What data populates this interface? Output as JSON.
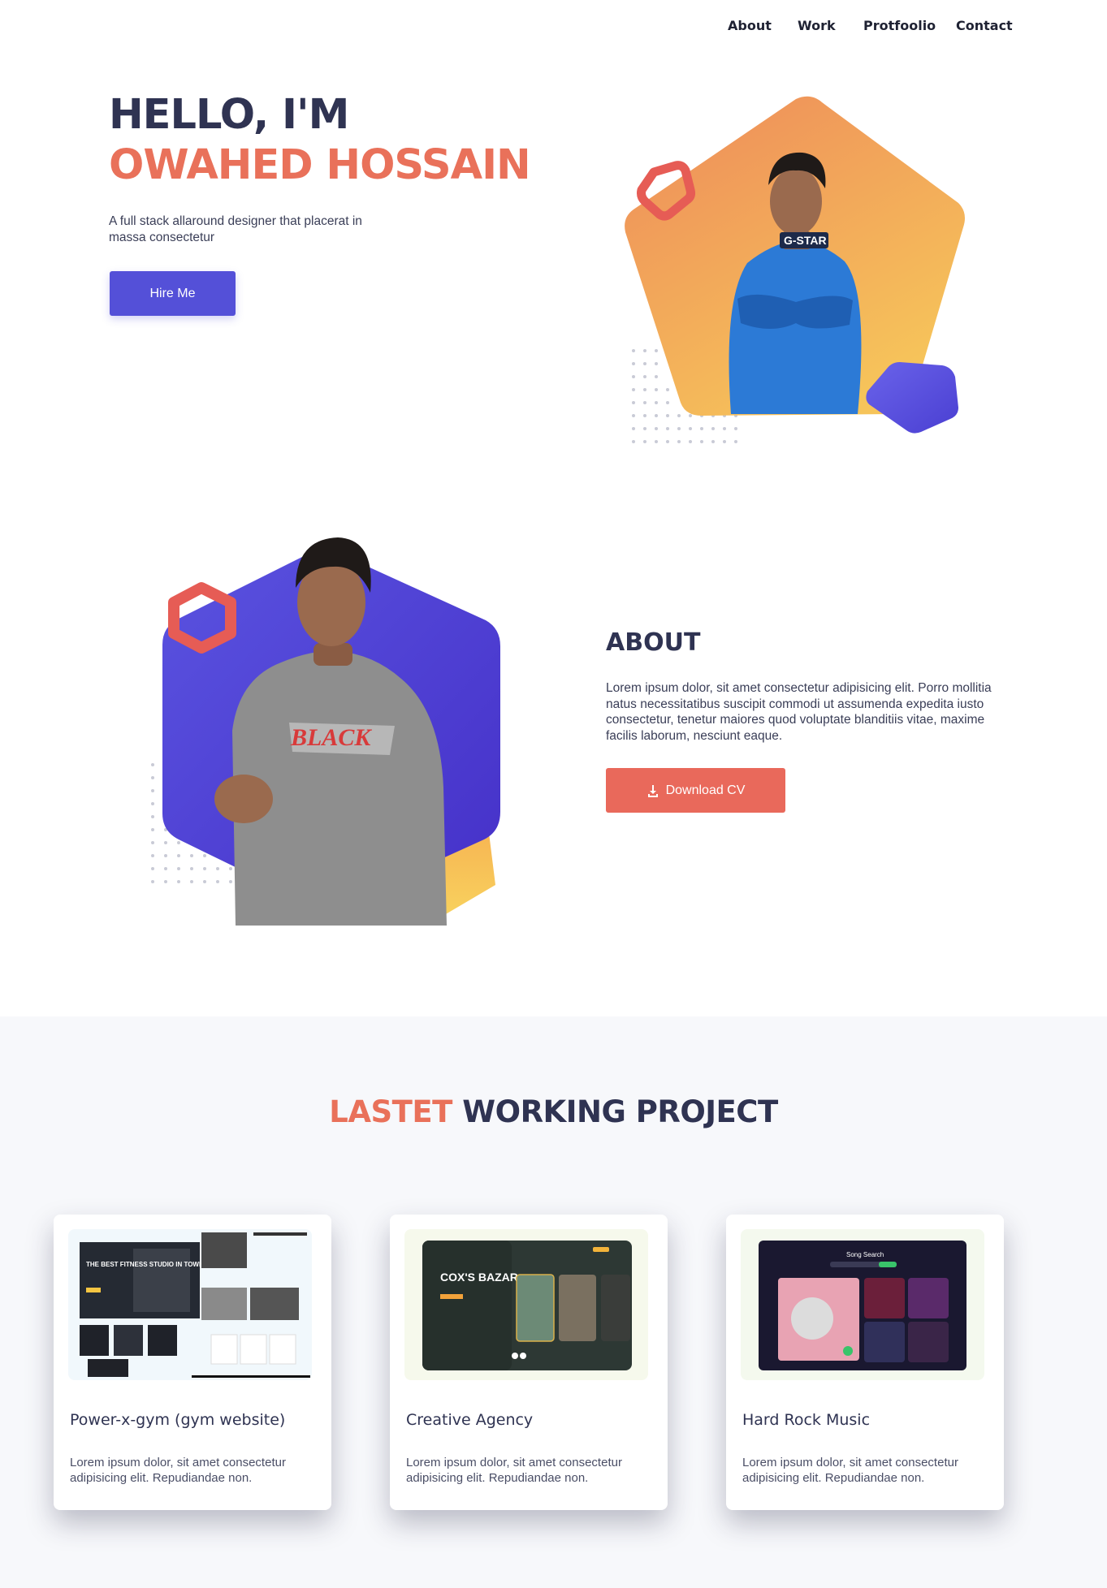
{
  "nav": {
    "items": [
      {
        "label": "About"
      },
      {
        "label": "Work"
      },
      {
        "label": "Protfoolio"
      },
      {
        "label": "Contact"
      }
    ]
  },
  "hero": {
    "greeting": "HELLO, I'M",
    "name": "OWAHED HOSSAIN",
    "description": "A full stack allaround designer that placerat in massa consectetur",
    "hire_button": "Hire Me"
  },
  "about": {
    "title": "ABOUT",
    "text": "Lorem ipsum dolor, sit amet consectetur adipisicing elit. Porro mollitia natus necessitatibus suscipit commodi ut assumenda expedita iusto consectetur, tenetur maiores quod voluptate blanditiis vitae, maxime facilis laborum, nesciunt eaque.",
    "download_button": "Download CV"
  },
  "projects": {
    "title_accent": "LASTET",
    "title_rest": "WORKING PROJECT",
    "cards": [
      {
        "title": "Power-x-gym (gym website)",
        "desc": "Lorem ipsum dolor, sit amet consectetur adipisicing elit. Repudiandae non.",
        "thumb_text": "THE BEST FITNESS STUDIO IN TOWN"
      },
      {
        "title": "Creative Agency",
        "desc": "Lorem ipsum dolor, sit amet consectetur adipisicing elit. Repudiandae non.",
        "thumb_text": "COX'S BAZAR"
      },
      {
        "title": "Hard Rock Music",
        "desc": "Lorem ipsum dolor, sit amet consectetur adipisicing elit. Repudiandae non.",
        "thumb_text": "Song Search"
      }
    ]
  },
  "colors": {
    "accent_orange": "#e9715a",
    "primary_indigo": "#5450d8",
    "heading_navy": "#2f3352"
  }
}
